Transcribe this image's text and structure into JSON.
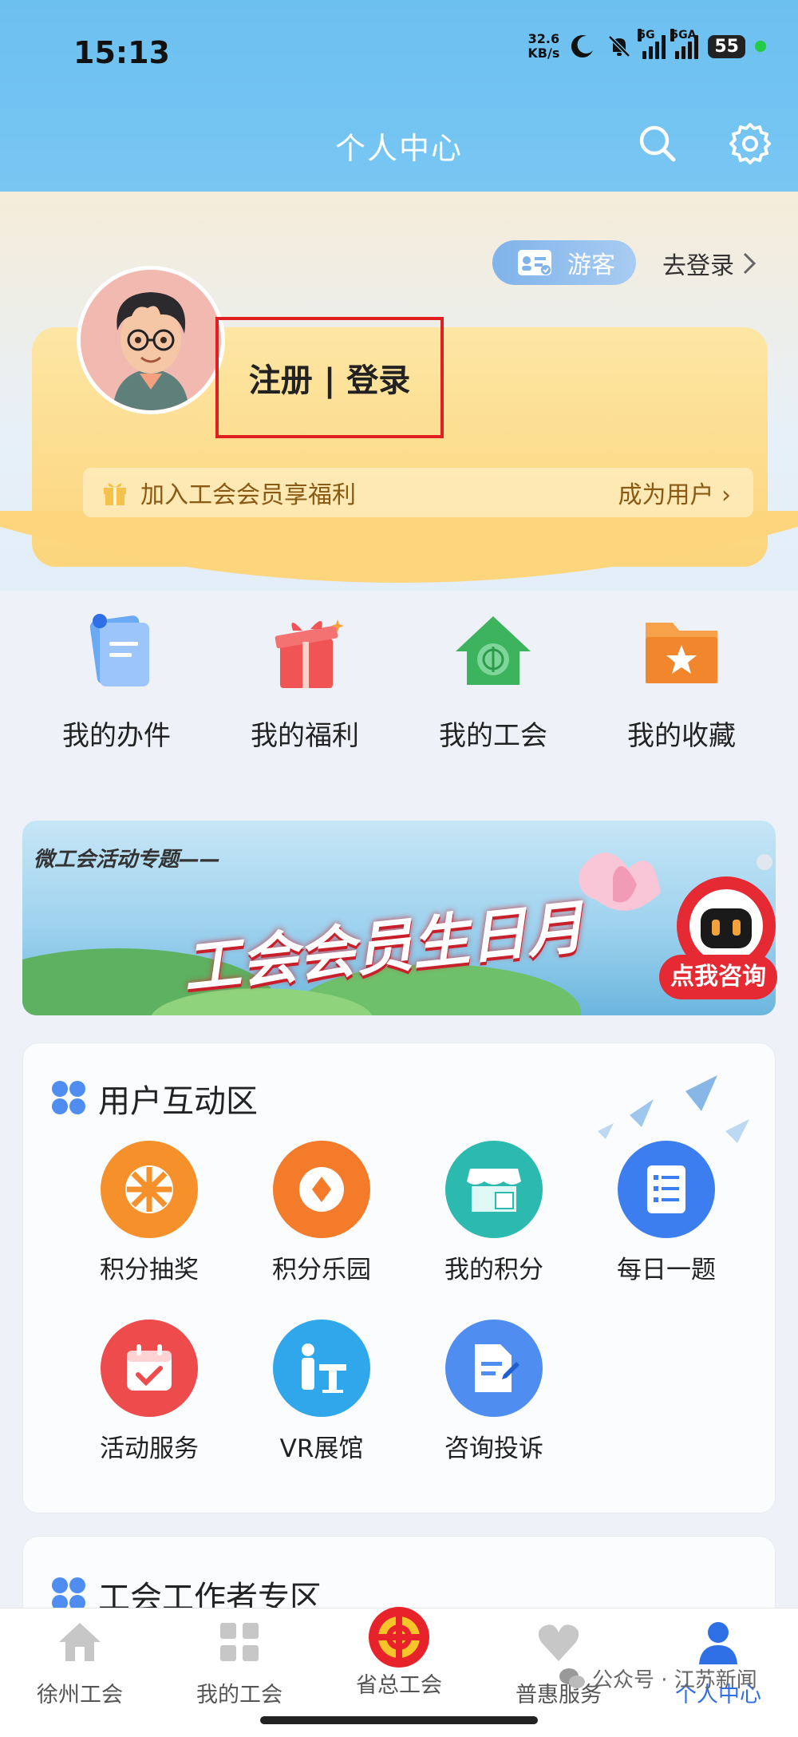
{
  "status_bar": {
    "time": "15:13",
    "speed": "32.6",
    "speed_unit": "KB/s",
    "net1": "5G",
    "net2": "5GA",
    "battery": "55"
  },
  "header": {
    "title": "个人中心"
  },
  "profile": {
    "guest_label": "游客",
    "goto_login": "去登录",
    "register_login": "注册 | 登录",
    "join_text": "加入工会会员享福利",
    "become_user": "成为用户 ›"
  },
  "quick_grid": [
    {
      "label": "我的办件",
      "icon": "document-icon"
    },
    {
      "label": "我的福利",
      "icon": "gift-icon"
    },
    {
      "label": "我的工会",
      "icon": "union-house-icon"
    },
    {
      "label": "我的收藏",
      "icon": "folder-star-icon"
    }
  ],
  "banner": {
    "subtitle": "微工会活动专题——",
    "title": "工会会员生日月",
    "consult": "点我咨询"
  },
  "interaction_zone": {
    "title": "用户互动区",
    "items": [
      {
        "label": "积分抽奖",
        "icon": "lottery-wheel-icon",
        "color": "#f6902a"
      },
      {
        "label": "积分乐园",
        "icon": "coin-icon",
        "color": "#f47b2a"
      },
      {
        "label": "我的积分",
        "icon": "shop-icon",
        "color": "#2bb9b0"
      },
      {
        "label": "每日一题",
        "icon": "checklist-icon",
        "color": "#3c7ef0"
      },
      {
        "label": "活动服务",
        "icon": "calendar-check-icon",
        "color": "#ee4c4c"
      },
      {
        "label": "VR展馆",
        "icon": "vr-exhibit-icon",
        "color": "#2fa7ea"
      },
      {
        "label": "咨询投诉",
        "icon": "consult-doc-icon",
        "color": "#4f8ef0"
      }
    ]
  },
  "worker_zone": {
    "title": "工会工作者专区"
  },
  "bottom_nav": [
    {
      "label": "徐州工会",
      "icon": "home-icon",
      "active": false
    },
    {
      "label": "我的工会",
      "icon": "grid-icon",
      "active": false
    },
    {
      "label": "省总工会",
      "icon": "union-emblem-icon",
      "active": false
    },
    {
      "label": "普惠服务",
      "icon": "heart-icon",
      "active": false
    },
    {
      "label": "个人中心",
      "icon": "person-icon",
      "active": true
    }
  ],
  "watermark": "公众号 · 江苏新闻"
}
